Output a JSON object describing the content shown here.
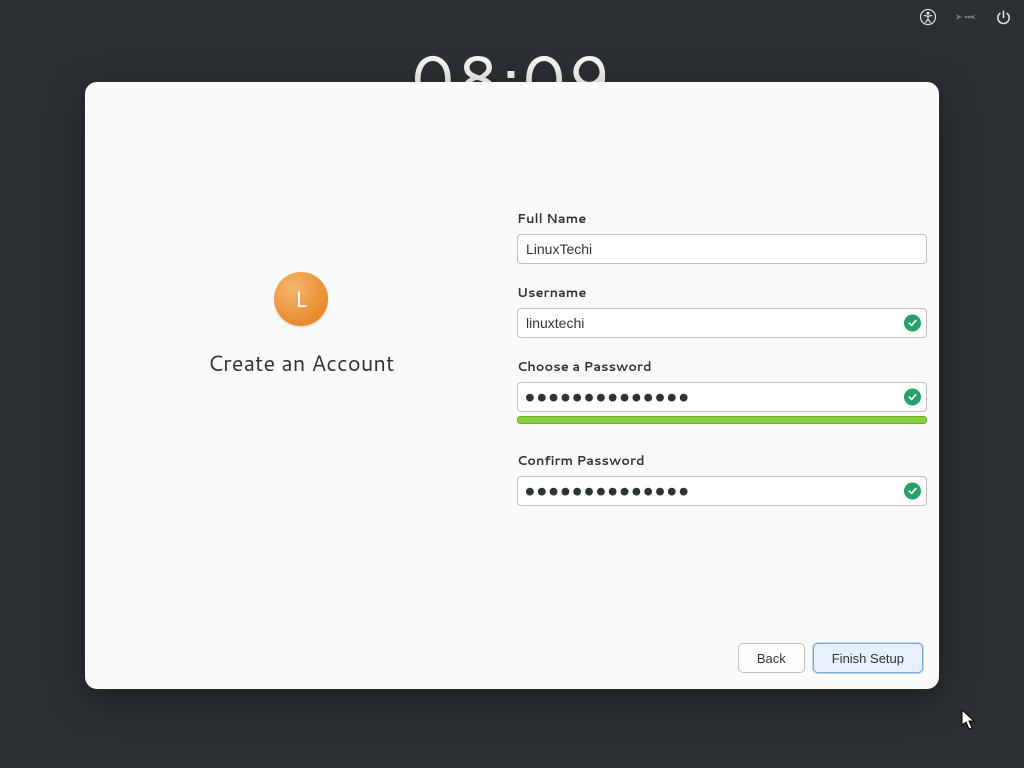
{
  "topbar": {
    "clock": "08:09"
  },
  "dialog": {
    "avatar_letter": "L",
    "title": "Create an Account",
    "form": {
      "fullname": {
        "label": "Full Name",
        "value": "LinuxTechi"
      },
      "username": {
        "label": "Username",
        "value": "linuxtechi",
        "valid": true
      },
      "password": {
        "label": "Choose a Password",
        "masked": "●●●●●●●●●●●●●●",
        "valid": true
      },
      "confirm": {
        "label": "Confirm Password",
        "masked": "●●●●●●●●●●●●●●",
        "valid": true
      }
    },
    "buttons": {
      "back": "Back",
      "finish": "Finish Setup"
    }
  }
}
